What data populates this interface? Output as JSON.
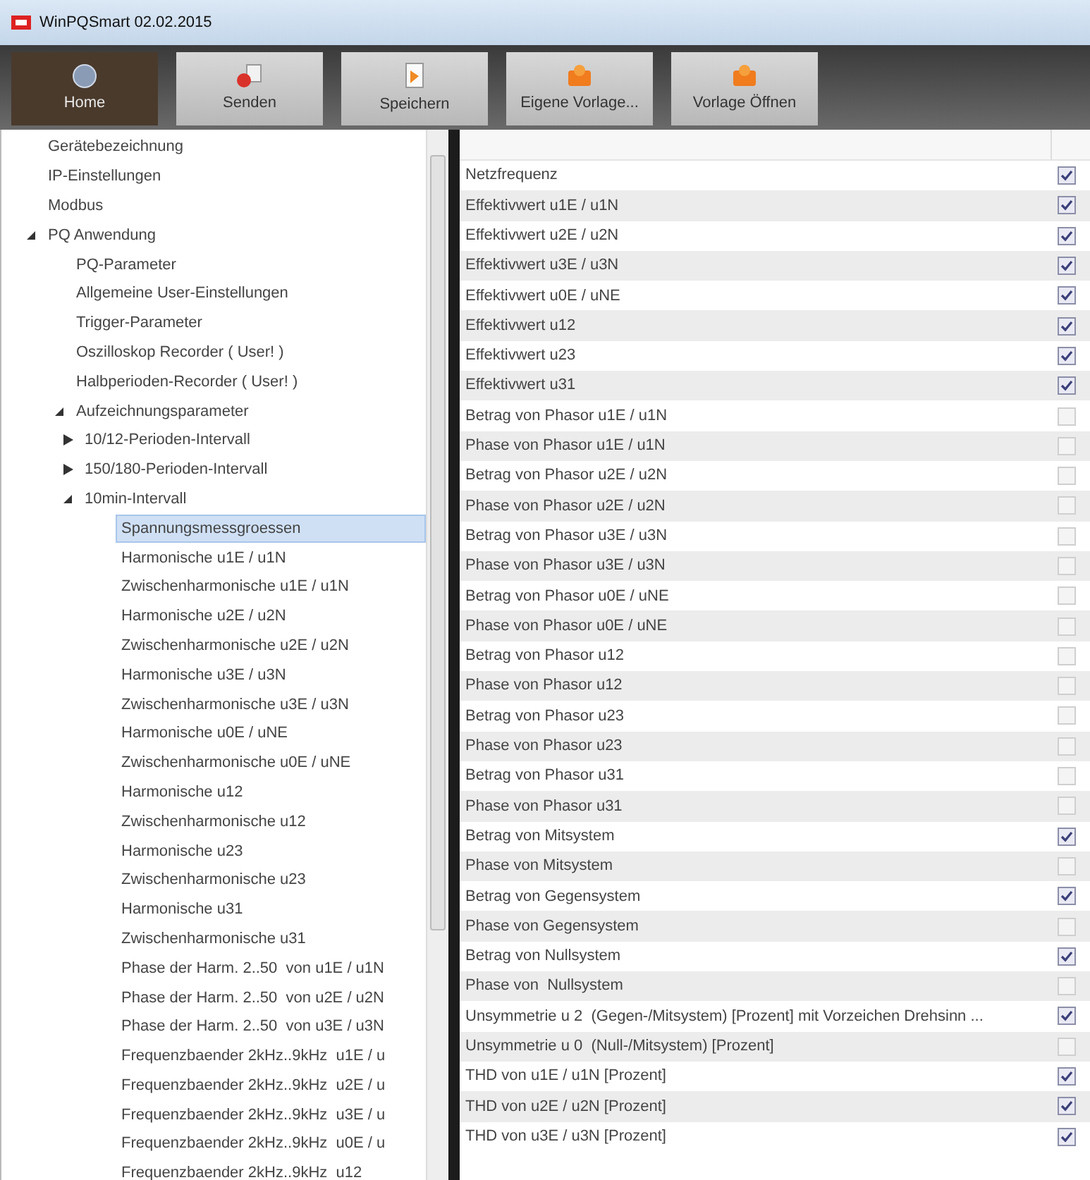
{
  "window": {
    "title": "WinPQSmart 02.02.2015"
  },
  "toolbar": [
    {
      "label": "Home",
      "selected": true,
      "kind": "home"
    },
    {
      "label": "Senden",
      "selected": false,
      "kind": "send"
    },
    {
      "label": "Speichern",
      "selected": false,
      "kind": "save"
    },
    {
      "label": "Eigene Vorlage...",
      "selected": false,
      "kind": "template"
    },
    {
      "label": "Vorlage Öffnen",
      "selected": false,
      "kind": "template"
    }
  ],
  "tree": [
    {
      "label": "Gerätebezeichnung",
      "selected": false
    },
    {
      "label": "IP-Einstellungen",
      "selected": false
    },
    {
      "label": "Modbus",
      "selected": false
    },
    {
      "label": "PQ Anwendung",
      "selected": false,
      "expanded": true,
      "children": [
        {
          "label": "PQ-Parameter",
          "selected": false
        },
        {
          "label": "Allgemeine User-Einstellungen",
          "selected": false
        },
        {
          "label": "Trigger-Parameter",
          "selected": false
        },
        {
          "label": "Oszilloskop Recorder ( User! )",
          "selected": false
        },
        {
          "label": "Halbperioden-Recorder ( User! )",
          "selected": false
        },
        {
          "label": "Aufzeichnungsparameter",
          "selected": false,
          "expanded": true,
          "children": [
            {
              "label": "10/12-Perioden-Intervall",
              "selected": false,
              "expanded": false
            },
            {
              "label": "150/180-Perioden-Intervall",
              "selected": false,
              "expanded": false
            },
            {
              "label": "10min-Intervall",
              "selected": false,
              "expanded": true,
              "children": [
                {
                  "label": "Spannungsmessgroessen",
                  "selected": true
                },
                {
                  "label": "Harmonische u1E / u1N",
                  "selected": false
                },
                {
                  "label": "Zwischenharmonische u1E / u1N",
                  "selected": false
                },
                {
                  "label": "Harmonische u2E / u2N",
                  "selected": false
                },
                {
                  "label": "Zwischenharmonische u2E / u2N",
                  "selected": false
                },
                {
                  "label": "Harmonische u3E / u3N",
                  "selected": false
                },
                {
                  "label": "Zwischenharmonische u3E / u3N",
                  "selected": false
                },
                {
                  "label": "Harmonische u0E / uNE",
                  "selected": false
                },
                {
                  "label": "Zwischenharmonische u0E / uNE",
                  "selected": false
                },
                {
                  "label": "Harmonische u12",
                  "selected": false
                },
                {
                  "label": "Zwischenharmonische u12",
                  "selected": false
                },
                {
                  "label": "Harmonische u23",
                  "selected": false
                },
                {
                  "label": "Zwischenharmonische u23",
                  "selected": false
                },
                {
                  "label": "Harmonische u31",
                  "selected": false
                },
                {
                  "label": "Zwischenharmonische u31",
                  "selected": false
                },
                {
                  "label": "Phase der Harm. 2..50  von u1E / u1N",
                  "selected": false
                },
                {
                  "label": "Phase der Harm. 2..50  von u2E / u2N",
                  "selected": false
                },
                {
                  "label": "Phase der Harm. 2..50  von u3E / u3N",
                  "selected": false
                },
                {
                  "label": "Frequenzbaender 2kHz..9kHz  u1E / u",
                  "selected": false
                },
                {
                  "label": "Frequenzbaender 2kHz..9kHz  u2E / u",
                  "selected": false
                },
                {
                  "label": "Frequenzbaender 2kHz..9kHz  u3E / u",
                  "selected": false
                },
                {
                  "label": "Frequenzbaender 2kHz..9kHz  u0E / u",
                  "selected": false
                },
                {
                  "label": "Frequenzbaender 2kHz..9kHz  u12",
                  "selected": false
                }
              ]
            }
          ]
        }
      ]
    }
  ],
  "measurements": [
    {
      "label": "Netzfrequenz",
      "checked": true
    },
    {
      "label": "Effektivwert u1E / u1N",
      "checked": true
    },
    {
      "label": "Effektivwert u2E / u2N",
      "checked": true
    },
    {
      "label": "Effektivwert u3E / u3N",
      "checked": true
    },
    {
      "label": "Effektivwert u0E / uNE",
      "checked": true
    },
    {
      "label": "Effektivwert u12",
      "checked": true
    },
    {
      "label": "Effektivwert u23",
      "checked": true
    },
    {
      "label": "Effektivwert u31",
      "checked": true
    },
    {
      "label": "Betrag von Phasor u1E / u1N",
      "checked": false
    },
    {
      "label": "Phase von Phasor u1E / u1N",
      "checked": false
    },
    {
      "label": "Betrag von Phasor u2E / u2N",
      "checked": false
    },
    {
      "label": "Phase von Phasor u2E / u2N",
      "checked": false
    },
    {
      "label": "Betrag von Phasor u3E / u3N",
      "checked": false
    },
    {
      "label": "Phase von Phasor u3E / u3N",
      "checked": false
    },
    {
      "label": "Betrag von Phasor u0E / uNE",
      "checked": false
    },
    {
      "label": "Phase von Phasor u0E / uNE",
      "checked": false
    },
    {
      "label": "Betrag von Phasor u12",
      "checked": false
    },
    {
      "label": "Phase von Phasor u12",
      "checked": false
    },
    {
      "label": "Betrag von Phasor u23",
      "checked": false
    },
    {
      "label": "Phase von Phasor u23",
      "checked": false
    },
    {
      "label": "Betrag von Phasor u31",
      "checked": false
    },
    {
      "label": "Phase von Phasor u31",
      "checked": false
    },
    {
      "label": "Betrag von Mitsystem",
      "checked": true
    },
    {
      "label": "Phase von Mitsystem",
      "checked": false
    },
    {
      "label": "Betrag von Gegensystem",
      "checked": true
    },
    {
      "label": "Phase von Gegensystem",
      "checked": false
    },
    {
      "label": "Betrag von Nullsystem",
      "checked": true
    },
    {
      "label": "Phase von  Nullsystem",
      "checked": false
    },
    {
      "label": "Unsymmetrie u 2  (Gegen-/Mitsystem) [Prozent] mit Vorzeichen Drehsinn ...",
      "checked": true
    },
    {
      "label": "Unsymmetrie u 0  (Null-/Mitsystem) [Prozent]",
      "checked": false
    },
    {
      "label": "THD von u1E / u1N [Prozent]",
      "checked": true
    },
    {
      "label": "THD von u2E / u2N [Prozent]",
      "checked": true
    },
    {
      "label": "THD von u3E / u3N [Prozent]",
      "checked": true
    }
  ]
}
